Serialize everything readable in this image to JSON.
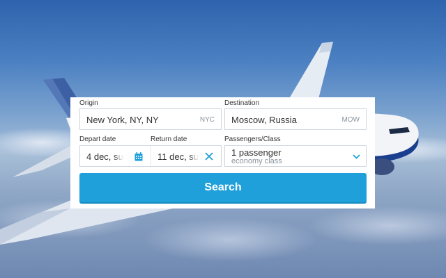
{
  "search_form": {
    "origin": {
      "label": "Origin",
      "value": "New York, NY,  NY",
      "code": "NYC"
    },
    "destination": {
      "label": "Destination",
      "value": "Moscow,  Russia",
      "code": "MOW"
    },
    "depart": {
      "label": "Depart date",
      "value": "4 dec, su",
      "icon": "calendar-icon"
    },
    "return": {
      "label": "Return date",
      "value": "11 dec, su",
      "icon": "close-icon"
    },
    "passengers": {
      "label": "Passengers/Class",
      "count": "1 passenger",
      "class": "economy class",
      "icon": "chevron-down-icon"
    },
    "search_button": "Search"
  },
  "colors": {
    "accent": "#1fa0da",
    "field_border": "#cfd6de",
    "muted_text": "#8a949e"
  }
}
